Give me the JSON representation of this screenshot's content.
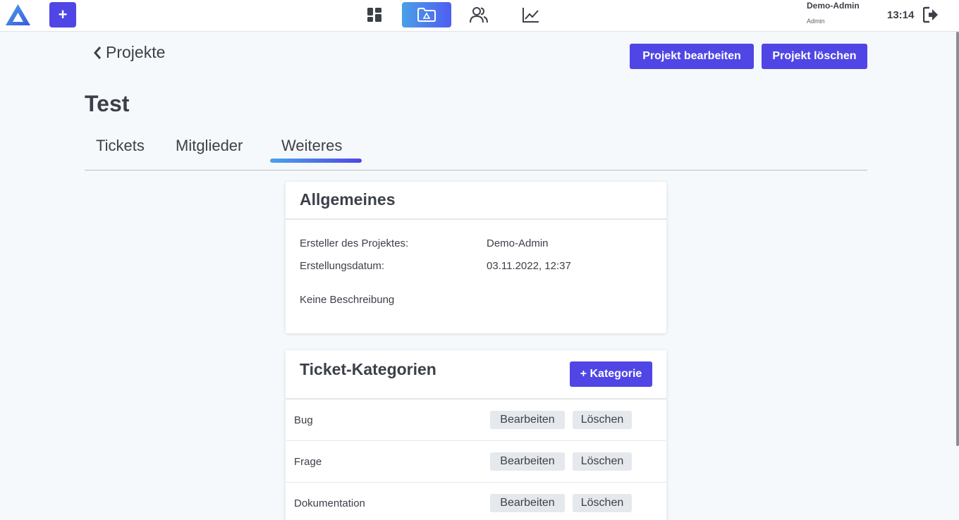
{
  "user": {
    "name": "Demo-Admin",
    "role": "Admin"
  },
  "clock": "13:14",
  "nav": {
    "add_label": "+",
    "icons": [
      "dashboard-icon",
      "projects-folder-icon",
      "users-icon",
      "statistics-icon"
    ]
  },
  "header": {
    "back_label": "Projekte",
    "edit_label": "Projekt bearbeiten",
    "delete_label": "Projekt löschen"
  },
  "project": {
    "title": "Test"
  },
  "tabs": [
    {
      "label": "Tickets"
    },
    {
      "label": "Mitglieder"
    },
    {
      "label": "Weiteres"
    }
  ],
  "general": {
    "title": "Allgemeines",
    "creator_label": "Ersteller des Projektes:",
    "creator_value": "Demo-Admin",
    "date_label": "Erstellungsdatum:",
    "date_value": "03.11.2022, 12:37",
    "description": "Keine Beschreibung"
  },
  "categories": {
    "title": "Ticket-Kategorien",
    "add_label": "+ Kategorie",
    "edit_label": "Bearbeiten",
    "delete_label": "Löschen",
    "items": [
      {
        "name": "Bug"
      },
      {
        "name": "Frage"
      },
      {
        "name": "Dokumentation"
      }
    ]
  },
  "colors": {
    "accent": "#4f46e5",
    "active_nav_start": "#4a9fe8",
    "background": "#f6f9fb"
  }
}
